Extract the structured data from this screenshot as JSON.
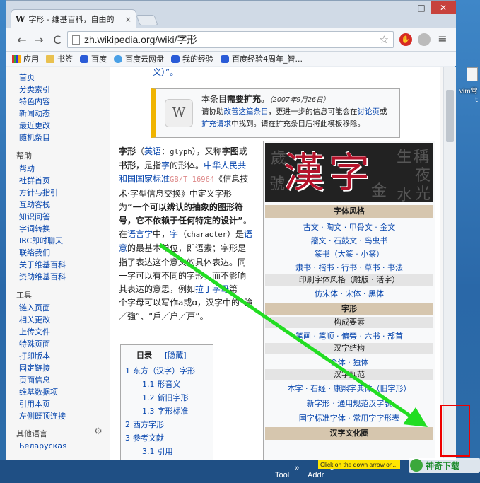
{
  "desktop": {
    "icon_label": "vim常",
    "icon_sub": "t"
  },
  "tab": {
    "favicon": "W",
    "title": "字形 - 维基百科，自由的",
    "close": "×"
  },
  "window_controls": {
    "minimize": "—",
    "maximize": "□",
    "close": "✕"
  },
  "toolbar": {
    "back": "←",
    "forward": "→",
    "reload": "C",
    "url": "zh.wikipedia.org/wiki/字形",
    "star": "☆",
    "menu": "≡",
    "adblock": "✋"
  },
  "bookmarks": [
    {
      "label": "应用",
      "icon": "apps-grid-icon"
    },
    {
      "label": "书签",
      "icon": "folder-icon"
    },
    {
      "label": "百度",
      "icon": "baidu-paw-icon"
    },
    {
      "label": "百度云网盘",
      "icon": "cloud-icon"
    },
    {
      "label": "我的经验",
      "icon": "baidu-paw-icon"
    },
    {
      "label": "百度经验4周年_智...",
      "icon": "baidu-paw-icon"
    }
  ],
  "sidebar": {
    "nav": [
      "首页",
      "分类索引",
      "特色内容",
      "新闻动态",
      "最近更改",
      "随机条目"
    ],
    "help_head": "帮助",
    "help": [
      "帮助",
      "社群首页",
      "方针与指引",
      "互助客栈",
      "知识问答",
      "字词转换",
      "IRC即时聊天",
      "联络我们",
      "关于维基百科",
      "资助维基百科"
    ],
    "tools_head": "工具",
    "tools": [
      "链入页面",
      "相关更改",
      "上传文件",
      "特殊页面",
      "打印版本",
      "固定链接",
      "页面信息",
      "维基数据项",
      "引用本页",
      "左侧既顶连接"
    ],
    "lang_head": "其他语言",
    "lang": [
      "Беларуская"
    ]
  },
  "content": {
    "top_snippet": "义）”。",
    "ambox": {
      "line1_a": "本条目",
      "line1_b": "需要扩充",
      "line1_c": "。",
      "date": "（2007年9月26日）",
      "line2_a": "请协助",
      "line2_link1": "改善这篇条目",
      "line2_b": "，更进一步的信息可能会在",
      "line2_link2": "讨论页",
      "line2_c": "或",
      "line3_link": "扩充请求",
      "line3_b": "中找到。请在扩充条目后将此模板移除。",
      "img": "W"
    },
    "article_html_parts": {
      "p1": "字形",
      "p2": "（",
      "p3": "英语",
      "p4": "：",
      "p5": "glyph",
      "p6": "），又称",
      "p7": "字图",
      "p8": "或",
      "p9": "书形",
      "p10": "，是指",
      "p11": "字",
      "p12": "的形体。",
      "p13": "中华人民共和国国家标准",
      "p14": "GB/T 16964",
      "p15": "《信息技术·字型信息交换》中定义字形为",
      "p16": "“一个可以辨认的抽象的图形符号，它不依赖于任何特定的设计”",
      "p17": "。在",
      "p18": "语言学",
      "p19": "中，",
      "p20": "字",
      "p21": "（",
      "p22": "character",
      "p23": "）是",
      "p24": "语意",
      "p25": "的最基本单位，即语素；字形是指了表达这个意义的具体表达。同一字可以有不同的字形，而不影响其表达的意思，例如",
      "p26": "拉丁字母",
      "p27": "第一个字母可以写作a或ɑ，汉字中的“強／強”、“戶／户／戸”。"
    },
    "toc": {
      "title": "目录",
      "toggle": "[隐藏]",
      "items": [
        {
          "num": "1",
          "label": "东方（汉字）字形",
          "level": 1
        },
        {
          "num": "1.1",
          "label": "形音义",
          "level": 2
        },
        {
          "num": "1.2",
          "label": "新旧字形",
          "level": 2
        },
        {
          "num": "1.3",
          "label": "字形标准",
          "level": 2
        },
        {
          "num": "2",
          "label": "西方字形",
          "level": 1
        },
        {
          "num": "3",
          "label": "参考文献",
          "level": 1
        },
        {
          "num": "3.1",
          "label": "引用",
          "level": 2
        }
      ]
    },
    "infobox": {
      "image_text": "漢字",
      "bg_glyphs": [
        "歲",
        "稱",
        "夜",
        "光",
        "號",
        "金",
        "生",
        "水"
      ],
      "h1": "字体风格",
      "r1": "古文 · 陶文 · 甲骨文 · 金文",
      "r2": "籀文 · 石鼓文 · 鸟虫书",
      "r3": "篆书（大篆 · 小篆）",
      "r4": "隶书 · 楷书 · 行书 · 草书 · 书法",
      "s1": "印刷字体风格（雕版 · 活字）",
      "r5": "仿宋体 · 宋体 · 黑体",
      "h2": "字形",
      "s2": "构成要素",
      "r6": "笔画 · 笔顺 · 偏旁 · 六书 · 部首",
      "s3": "汉字结构",
      "r7": "合体 · 独体",
      "s4": "汉字规范",
      "r8": "本字 · 石经 · 康熙字典体（旧字形）",
      "r9": "新字形 · 通用规范汉字表",
      "r10": "国字标准字体 · 常用字字形表",
      "h3": "汉字文化圈"
    }
  },
  "taskbar": {
    "tool": "Tool",
    "addr": "Addr",
    "arrows": "»",
    "tooltip": "Click on the down arrow on...",
    "watermark": "神奇下载"
  },
  "colors": {
    "accent_link": "#0645ad",
    "annotation_arrow": "#22dd22",
    "annotation_box": "#ee0000"
  }
}
